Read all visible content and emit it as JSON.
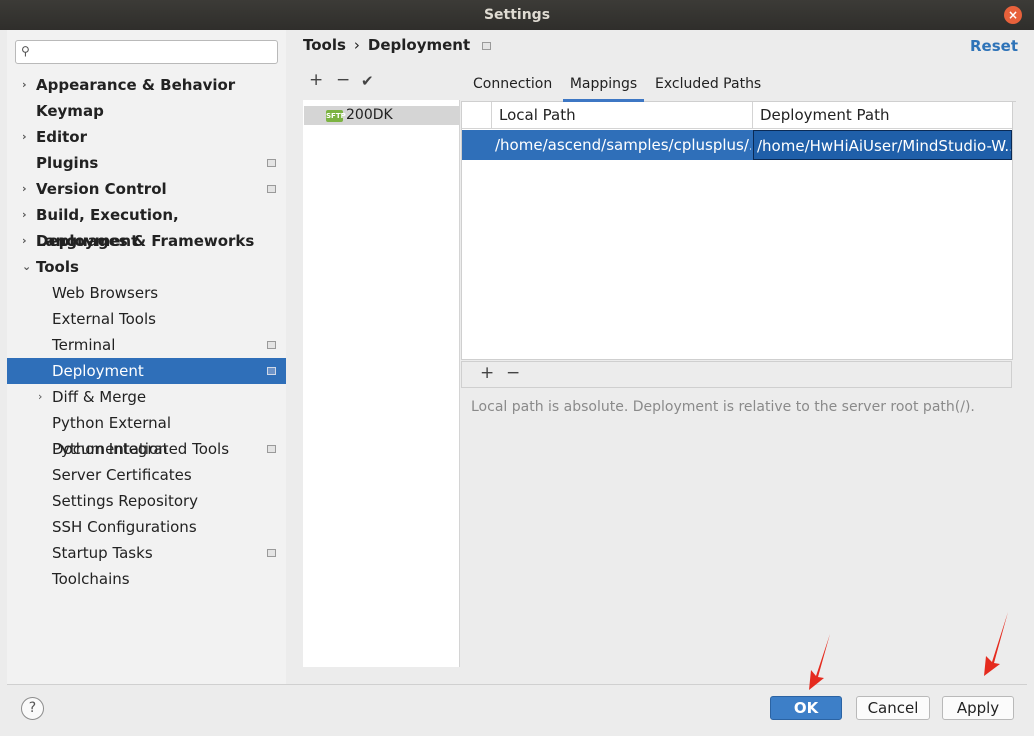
{
  "window": {
    "title": "Settings",
    "close_glyph": "×"
  },
  "search": {
    "placeholder": "",
    "icon": "search-icon"
  },
  "sidebar": {
    "items": [
      {
        "label": "Appearance & Behavior",
        "bold": true,
        "arrow": "›"
      },
      {
        "label": "Keymap",
        "bold": true
      },
      {
        "label": "Editor",
        "bold": true,
        "arrow": "›"
      },
      {
        "label": "Plugins",
        "bold": true,
        "project": true
      },
      {
        "label": "Version Control",
        "bold": true,
        "arrow": "›",
        "project": true
      },
      {
        "label": "Build, Execution, Deployment",
        "bold": true,
        "arrow": "›"
      },
      {
        "label": "Languages & Frameworks",
        "bold": true,
        "arrow": "›"
      },
      {
        "label": "Tools",
        "bold": true,
        "arrow": "⌄"
      },
      {
        "label": "Web Browsers"
      },
      {
        "label": "External Tools"
      },
      {
        "label": "Terminal",
        "project": true
      },
      {
        "label": "Deployment",
        "project": true,
        "selected": true
      },
      {
        "label": "Diff & Merge",
        "arrow": "›"
      },
      {
        "label": "Python External Documentation"
      },
      {
        "label": "Python Integrated Tools",
        "project": true
      },
      {
        "label": "Server Certificates"
      },
      {
        "label": "Settings Repository"
      },
      {
        "label": "SSH Configurations"
      },
      {
        "label": "Startup Tasks",
        "project": true
      },
      {
        "label": "Toolchains"
      }
    ]
  },
  "breadcrumb": {
    "parent": "Tools",
    "separator": "›",
    "current": "Deployment"
  },
  "reset_label": "Reset",
  "server_toolbar": {
    "add": "+",
    "remove": "−",
    "check": "✔"
  },
  "servers": [
    {
      "name": "200DK",
      "type_badge": "SFTP"
    }
  ],
  "tabs": [
    "Connection",
    "Mappings",
    "Excluded Paths"
  ],
  "active_tab": "Mappings",
  "mappings_table": {
    "columns": [
      "Local Path",
      "Deployment Path"
    ],
    "rows": [
      {
        "local": "/home/ascend/samples/cplusplus/...",
        "deployment": "/home/HwHiAiUser/MindStudio-W..."
      }
    ]
  },
  "table_toolbar": {
    "add": "+",
    "remove": "−"
  },
  "hint": "Local path is absolute. Deployment is relative to the server root path(/).",
  "footer": {
    "help": "?",
    "ok": "OK",
    "cancel": "Cancel",
    "apply": "Apply"
  },
  "colors": {
    "selection": "#2f6fb9",
    "accent": "#2e73b8",
    "annotation_arrow": "#e52b1e"
  }
}
